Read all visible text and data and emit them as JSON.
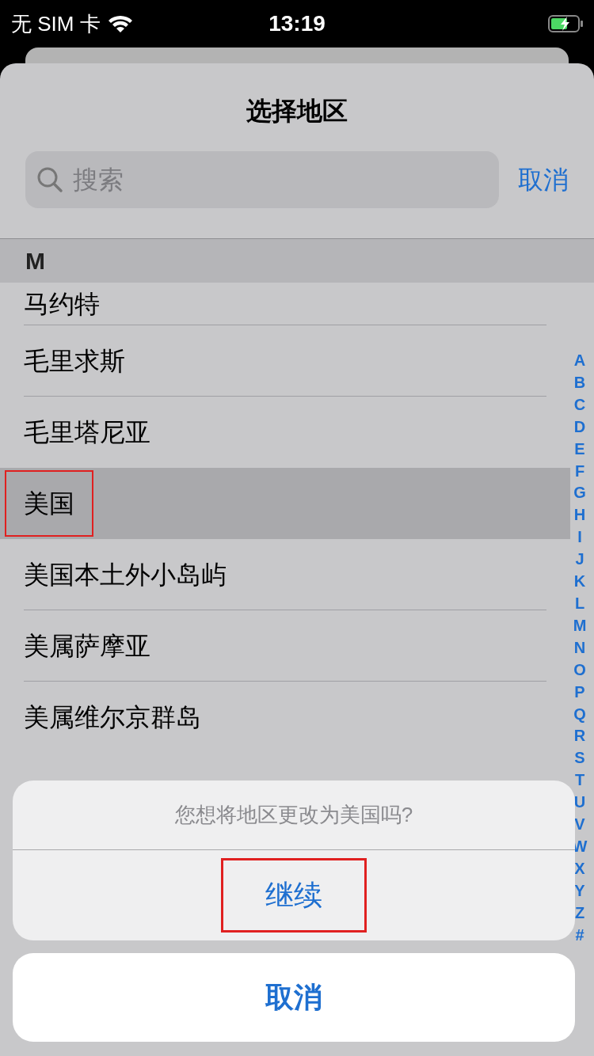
{
  "status_bar": {
    "carrier": "无 SIM 卡",
    "time": "13:19",
    "charging": true
  },
  "sheet": {
    "title": "选择地区",
    "search": {
      "placeholder": "搜索"
    },
    "cancel": "取消"
  },
  "section": {
    "header": "M",
    "rows": [
      {
        "label": "马约特",
        "selected": false,
        "highlighted": false
      },
      {
        "label": "毛里求斯",
        "selected": false,
        "highlighted": false
      },
      {
        "label": "毛里塔尼亚",
        "selected": false,
        "highlighted": false
      },
      {
        "label": "美国",
        "selected": true,
        "highlighted": true
      },
      {
        "label": "美国本土外小岛屿",
        "selected": false,
        "highlighted": false
      },
      {
        "label": "美属萨摩亚",
        "selected": false,
        "highlighted": false
      },
      {
        "label": "美属维尔京群岛",
        "selected": false,
        "highlighted": false
      }
    ]
  },
  "index": [
    "A",
    "B",
    "C",
    "D",
    "E",
    "F",
    "G",
    "H",
    "I",
    "J",
    "K",
    "L",
    "M",
    "N",
    "O",
    "P",
    "Q",
    "R",
    "S",
    "T",
    "U",
    "V",
    "W",
    "X",
    "Y",
    "Z",
    "#"
  ],
  "alert": {
    "message": "您想将地区更改为美国吗?",
    "actions": [
      {
        "label": "继续",
        "highlighted": true
      }
    ],
    "cancel": "取消"
  }
}
